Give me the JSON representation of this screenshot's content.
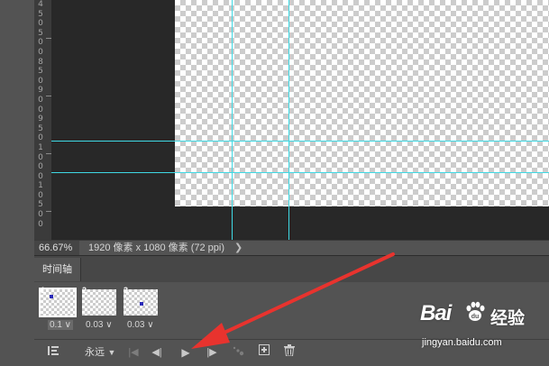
{
  "ruler": {
    "digits": [
      "4",
      "5",
      "0",
      "5",
      "0",
      "0",
      "8",
      "5",
      "0",
      "9",
      "0",
      "0",
      "9",
      "5",
      "0",
      "1",
      "0",
      "0",
      "0",
      "1",
      "0",
      "5",
      "0",
      "0"
    ]
  },
  "status_bar": {
    "zoom": "66.67%",
    "doc_info": "1920 像素 x 1080 像素 (72 ppi)",
    "expand_icon": "chevron-right-icon"
  },
  "timeline": {
    "tab_label": "时间轴",
    "frames": [
      {
        "number": "1",
        "delay": "0.1",
        "selected": true
      },
      {
        "number": "2",
        "delay": "0.03",
        "selected": false
      },
      {
        "number": "3",
        "delay": "0.03",
        "selected": false
      }
    ],
    "controls": {
      "convert_icon": "convert-to-video-timeline-icon",
      "loop_option": "永远",
      "first_frame_icon": "first-frame-icon",
      "prev_frame_icon": "previous-frame-icon",
      "play_icon": "play-icon",
      "next_frame_icon": "next-frame-icon",
      "tween_icon": "tween-icon",
      "new_frame_icon": "duplicate-frame-icon",
      "delete_icon": "trash-icon"
    }
  },
  "watermark": {
    "brand": "Bai",
    "brand_cn": "经验",
    "url": "jingyan.baidu.com"
  },
  "colors": {
    "guide": "#3fd9e4",
    "annotation_arrow": "#e8332e",
    "frame_dot": "#2a2ab8",
    "panel_bg": "#535353",
    "pasteboard": "#282828"
  }
}
